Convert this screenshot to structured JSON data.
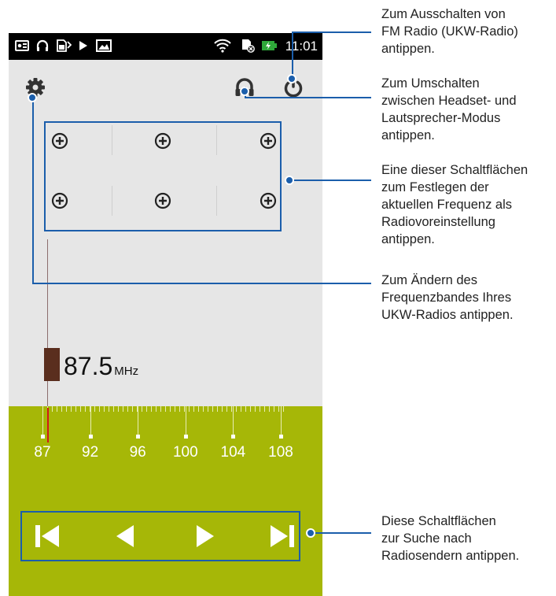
{
  "status_bar": {
    "time": "11:01",
    "left_icons": [
      "radio-icon",
      "headset-icon",
      "sim-icon",
      "play-icon",
      "image-icon"
    ],
    "right_icons": [
      "wifi-icon",
      "sd-card-icon",
      "battery-charging-icon"
    ]
  },
  "toolbar": {
    "settings_icon": "gear-icon",
    "output_icon": "headset-icon",
    "power_icon": "power-icon"
  },
  "presets": {
    "button_icon": "add-circle-icon",
    "count": 6
  },
  "tuner": {
    "frequency": "87.5",
    "unit": "MHz",
    "scale_labels": [
      "87",
      "92",
      "96",
      "100",
      "104",
      "108"
    ]
  },
  "controls": {
    "icons": [
      "skip-previous-icon",
      "seek-back-icon",
      "seek-forward-icon",
      "skip-next-icon"
    ]
  },
  "callouts": {
    "power": "Zum Ausschalten von\nFM Radio (UKW-Radio)\nantippen.",
    "headset": "Zum Umschalten\nzwischen Headset- und\nLautsprecher-Modus\nantippen.",
    "presets": "Eine dieser Schaltflächen\nzum Festlegen der\naktuellen Frequenz als\nRadiovoreinstellung\nantippen.",
    "band": "Zum Ändern des\nFrequenzbandes Ihres\nUKW-Radios antippen.",
    "search": "Diese Schaltflächen\nzur Suche nach\nRadiosendern antippen."
  },
  "colors": {
    "accent_green": "#a6b707",
    "callout_blue": "#1b5eab",
    "marker_brown": "#5a2e1e"
  }
}
